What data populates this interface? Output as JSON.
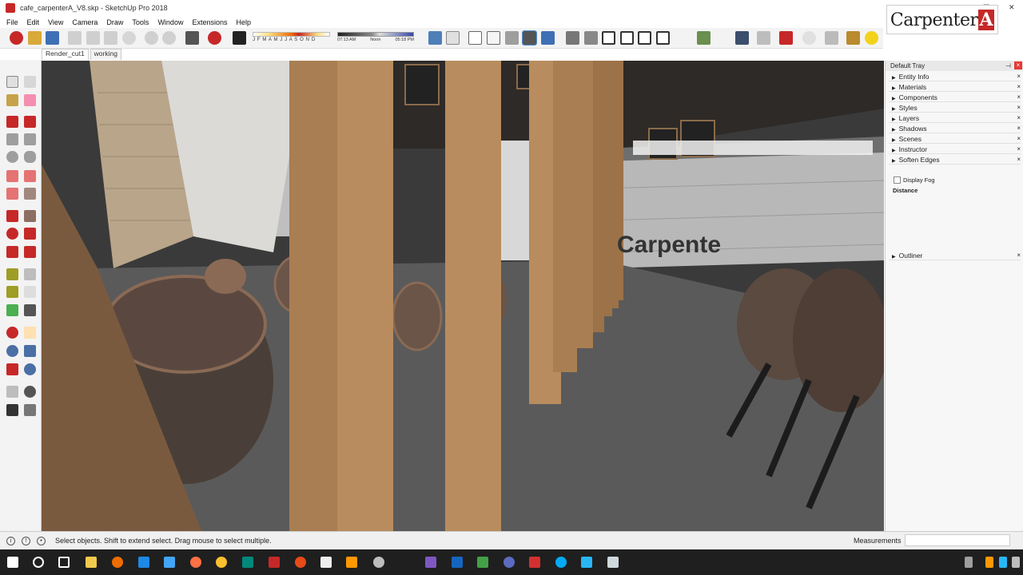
{
  "window": {
    "title": "cafe_carpenterA_V8.skp - SketchUp Pro 2018"
  },
  "menu": [
    "File",
    "Edit",
    "View",
    "Camera",
    "Draw",
    "Tools",
    "Window",
    "Extensions",
    "Help"
  ],
  "shadows": {
    "months": "J F M A M J J A S O N D",
    "time_start": "07:13 AM",
    "time_noon": "Noon",
    "time_end": "05:18 PM"
  },
  "scene_tabs": [
    "Render_cut1",
    "working"
  ],
  "logo": {
    "text": "Carpenter",
    "letter": "A"
  },
  "tray": {
    "title": "Default Tray",
    "panels": [
      "Entity Info",
      "Materials",
      "Components",
      "Styles",
      "Layers",
      "Shadows",
      "Scenes",
      "Instructor",
      "Soften Edges"
    ],
    "display_fog": "Display Fog",
    "distance": "Distance",
    "outliner": "Outliner"
  },
  "viewport": {
    "sign_text": "Carpente"
  },
  "status": {
    "message": "Select objects. Shift to extend select. Drag mouse to select multiple.",
    "measurements_label": "Measurements"
  },
  "colors": {
    "accent": "#c62828"
  }
}
